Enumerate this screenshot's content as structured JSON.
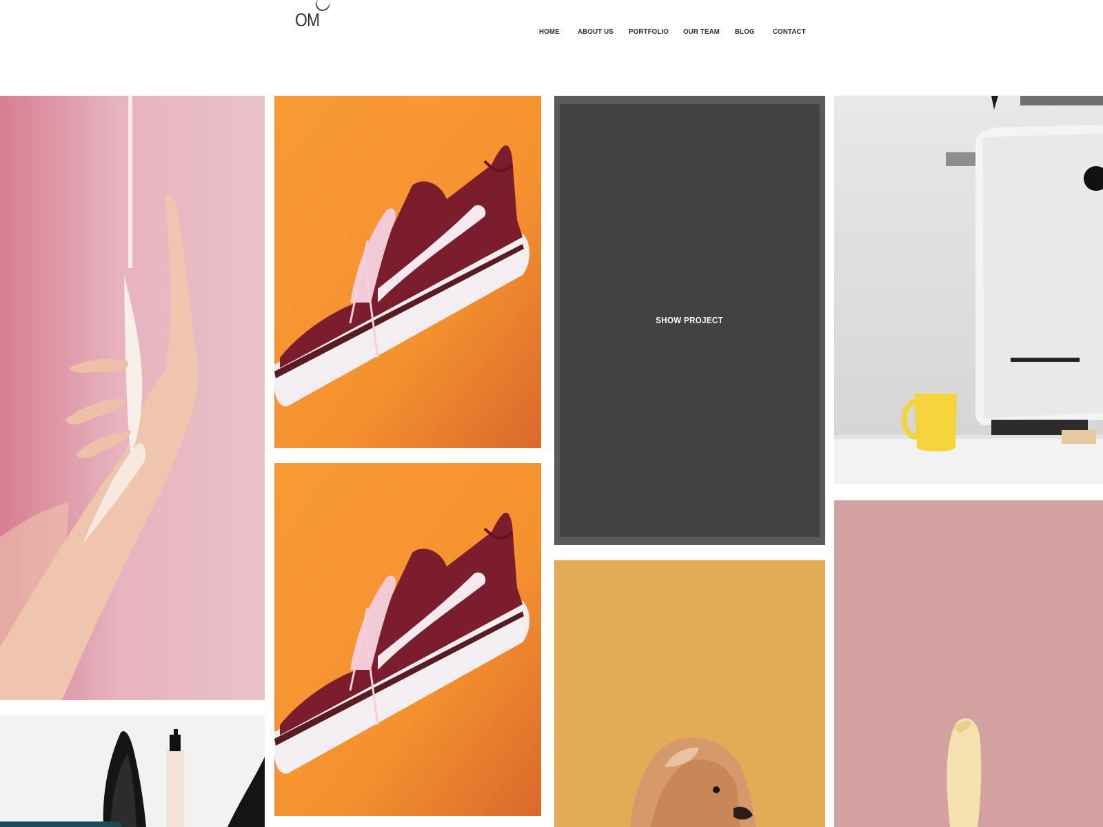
{
  "header": {
    "logo_text": "OM",
    "nav": [
      {
        "label": "HOME"
      },
      {
        "label": "ABOUT US"
      },
      {
        "label": "PORTFOLIO"
      },
      {
        "label": "OUR TEAM"
      },
      {
        "label": "BLOG"
      },
      {
        "label": "CONTACT"
      }
    ]
  },
  "portfolio": {
    "overlay_label": "SHOW PROJECT",
    "tiles": [
      {
        "subject": "hand-with-cream",
        "bg": "#e6b6c0"
      },
      {
        "subject": "sneaker",
        "bg": "#f39534"
      },
      {
        "subject": "sneaker",
        "bg": "#f39534"
      },
      {
        "subject": "project-overlay",
        "bg": "#434243"
      },
      {
        "subject": "dog",
        "bg": "#e2ab56"
      },
      {
        "subject": "desk-computer",
        "bg": "#dcdcdc"
      },
      {
        "subject": "banana",
        "bg": "#d3a2a0"
      },
      {
        "subject": "sunglasses-and-bottle",
        "bg": "#f1f1f1"
      }
    ]
  },
  "colors": {
    "nav_text": "#2d2d2d",
    "overlay_dark": "#434243",
    "overlay_border": "#5b5a5b",
    "status_bar": "#1f4a55"
  }
}
